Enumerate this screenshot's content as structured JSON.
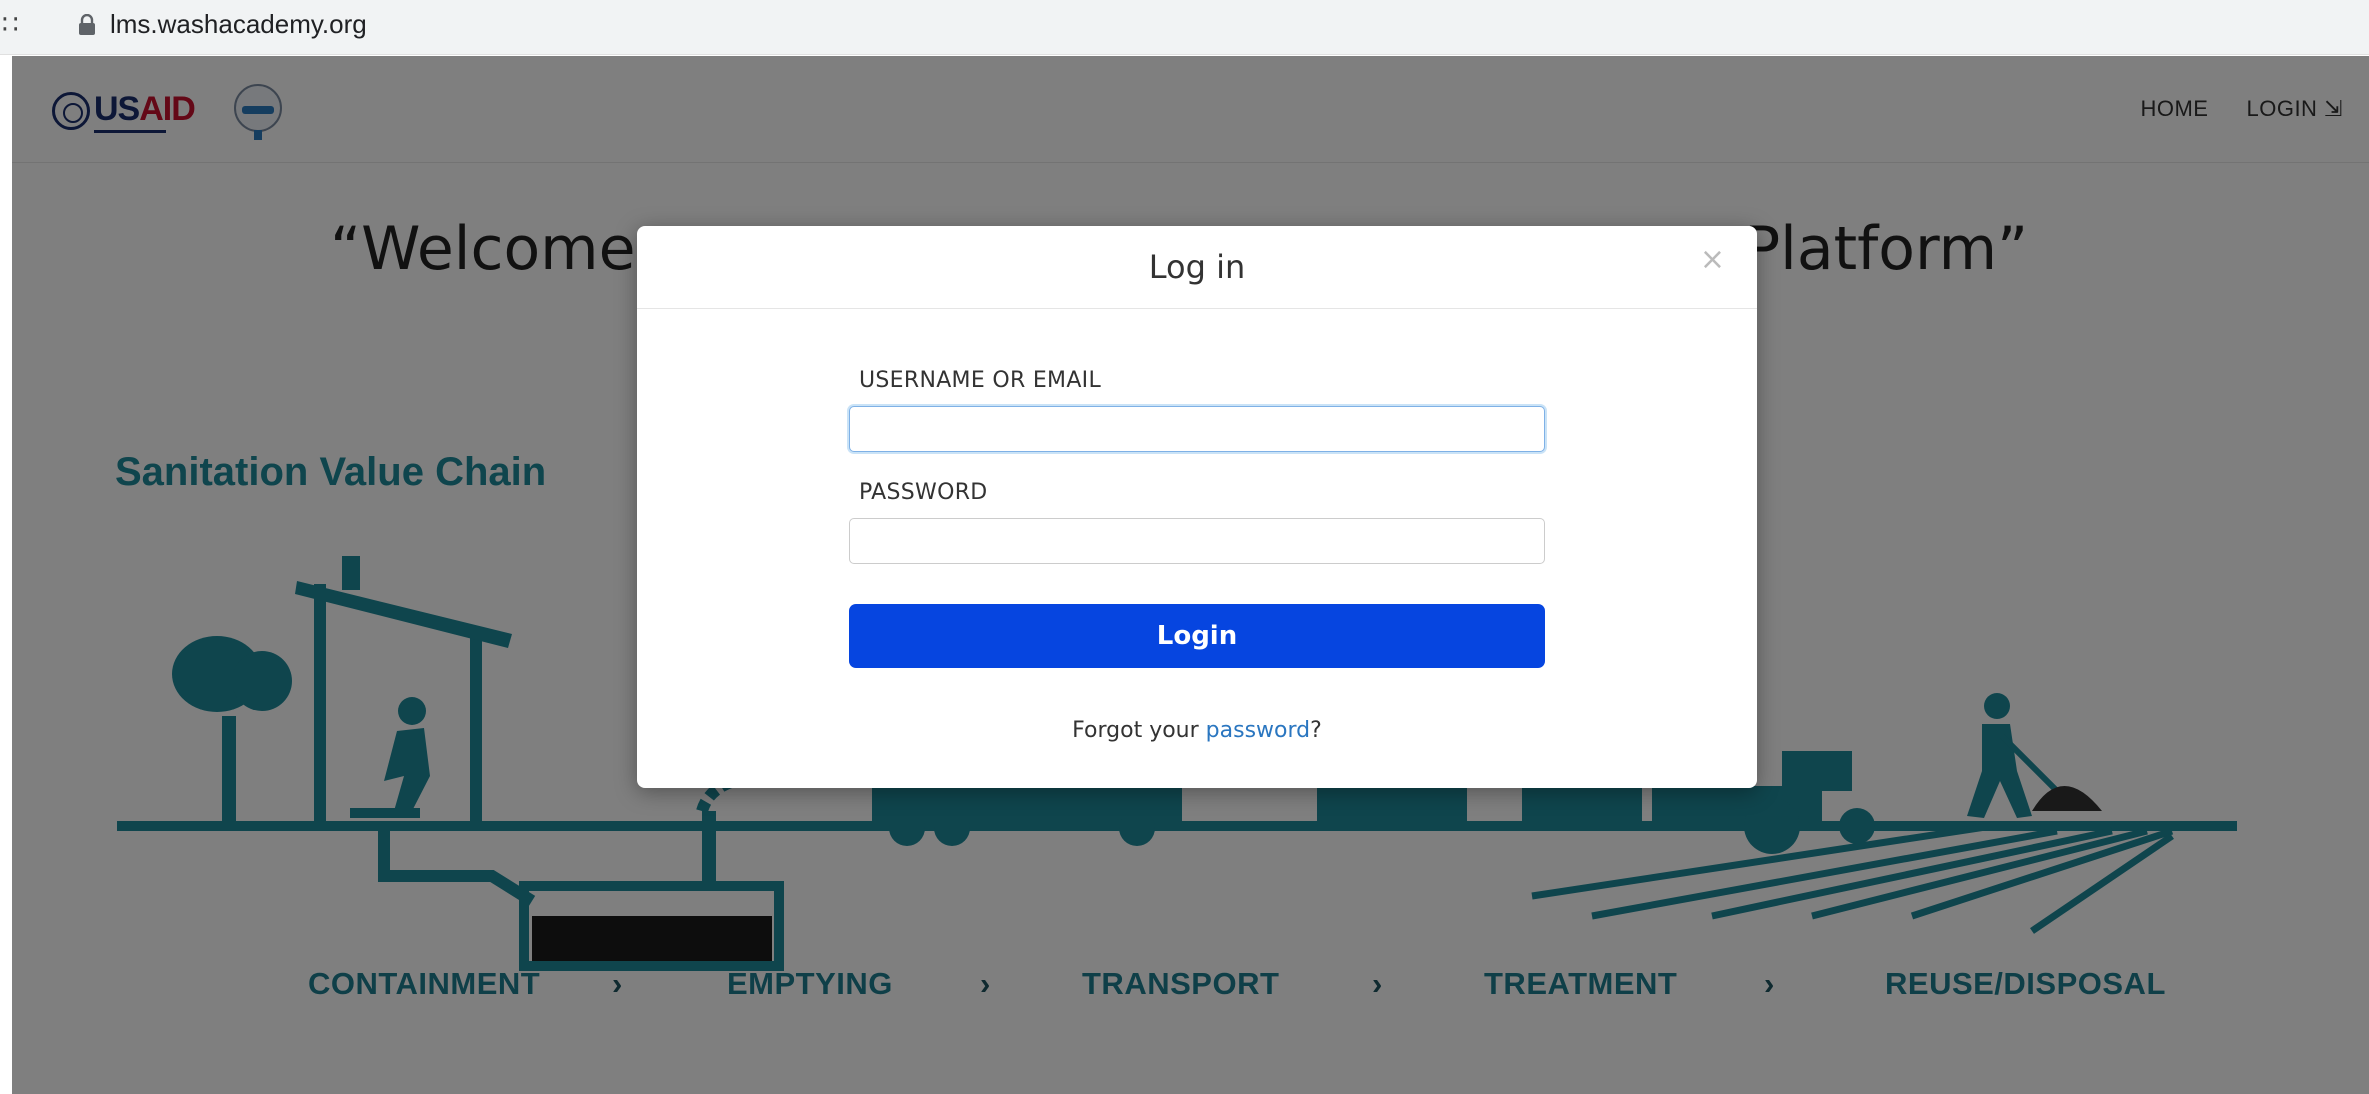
{
  "browser": {
    "url": "lms.washacademy.org"
  },
  "header": {
    "logo_usaid_text": "USAID",
    "logo_washacademy_name": "WASH Academy",
    "nav": {
      "home": "HOME",
      "login": "LOGIN ⇲"
    }
  },
  "hero": {
    "welcome_left": "“Welcome",
    "welcome_right": "Platform”"
  },
  "infographic": {
    "title": "Sanitation Value Chain",
    "stages": [
      "CONTAINMENT",
      "EMPTYING",
      "TRANSPORT",
      "TREATMENT",
      "REUSE/DISPOSAL"
    ],
    "arrow": "›",
    "color": "#1f8a9a"
  },
  "modal": {
    "title": "Log in",
    "close": "×",
    "username_label": "USERNAME OR EMAIL",
    "username_value": "",
    "password_label": "PASSWORD",
    "password_value": "",
    "login_button": "Login",
    "forgot_prefix": "Forgot your ",
    "forgot_link": "password",
    "forgot_suffix": "?",
    "button_color": "#0645e0"
  }
}
